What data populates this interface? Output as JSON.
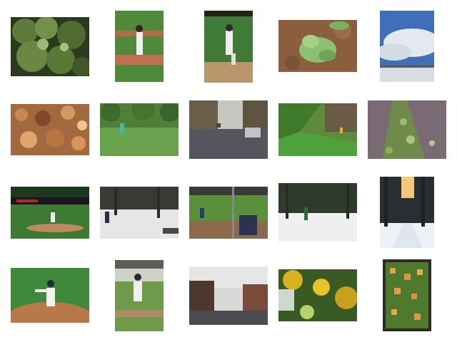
{
  "gallery": {
    "thumbnails": [
      {
        "id": "broccoli-closeup"
      },
      {
        "id": "baseball-player-standing"
      },
      {
        "id": "baseball-pitcher-on-mound"
      },
      {
        "id": "leafy-plant-on-soil"
      },
      {
        "id": "cloudy-sky-over-snow"
      },
      {
        "id": "pizza-closeup"
      },
      {
        "id": "frisbee-player-in-park"
      },
      {
        "id": "street-with-cars"
      },
      {
        "id": "grassy-hillside"
      },
      {
        "id": "leaves-on-path"
      },
      {
        "id": "baseball-field-night"
      },
      {
        "id": "snowy-trees-walker"
      },
      {
        "id": "baseball-behind-fence"
      },
      {
        "id": "skier-in-snowy-woods"
      },
      {
        "id": "snowy-forest-trail"
      },
      {
        "id": "pitcher-throwing"
      },
      {
        "id": "player-running-bases"
      },
      {
        "id": "tree-lined-street"
      },
      {
        "id": "yellow-flowers-blur"
      },
      {
        "id": "pizza-in-pan"
      }
    ]
  }
}
